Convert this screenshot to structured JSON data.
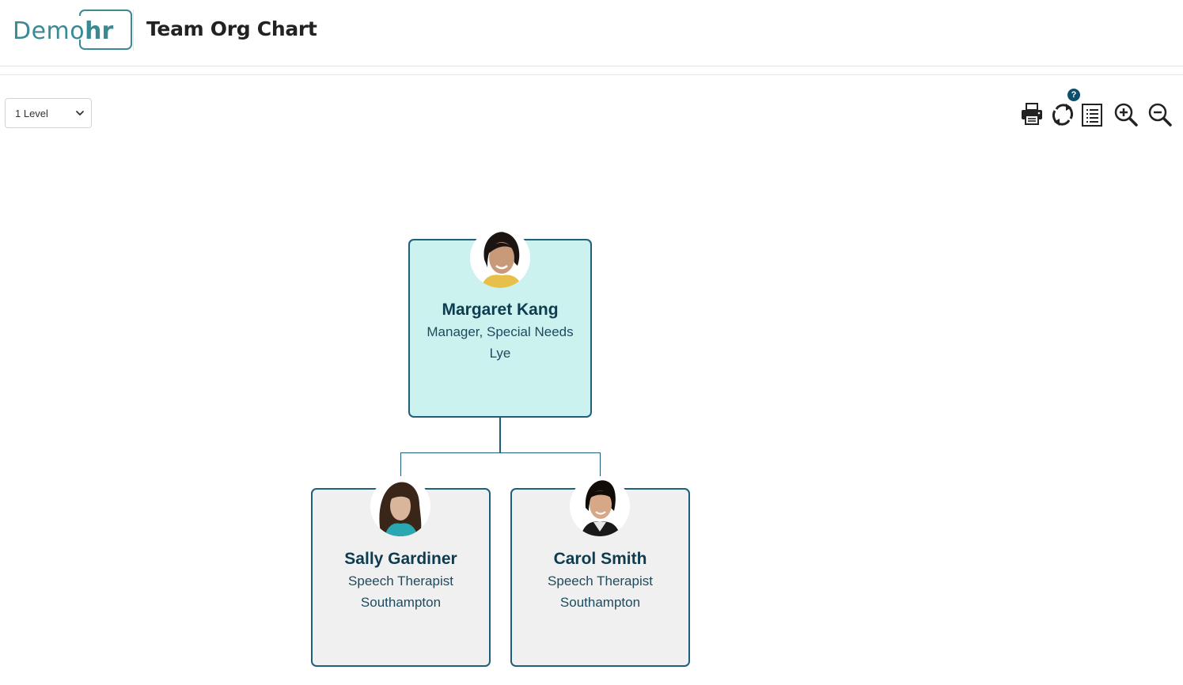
{
  "header": {
    "logo_text_left": "Demo",
    "logo_text_right": "hr",
    "title": "Team Org Chart"
  },
  "controls": {
    "level_select_value": "1 Level"
  },
  "toolbar": {
    "help_badge": "?",
    "icons": [
      "print-icon",
      "refresh-icon",
      "list-icon",
      "zoom-in-icon",
      "zoom-out-icon"
    ]
  },
  "org": {
    "root": {
      "name": "Margaret Kang",
      "title": "Manager, Special Needs",
      "location": "Lye"
    },
    "children": [
      {
        "name": "Sally Gardiner",
        "title": "Speech Therapist",
        "location": "Southampton"
      },
      {
        "name": "Carol Smith",
        "title": "Speech Therapist",
        "location": "Southampton"
      }
    ]
  },
  "colors": {
    "brand": "#3b8a93",
    "card_border": "#1f5f7a",
    "root_card_bg": "#ccf2ef",
    "child_card_bg": "#f0f0f0",
    "name_text": "#0d3b4f"
  }
}
